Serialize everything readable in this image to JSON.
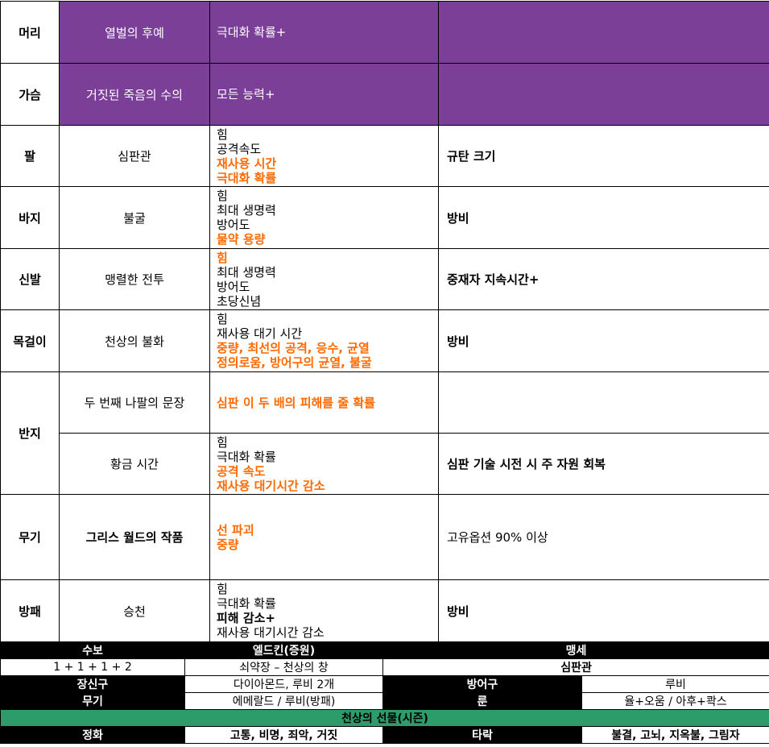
{
  "rows": {
    "head": {
      "slot": "머리",
      "item": "열벌의 후예",
      "stats": [
        "극대화 확률+"
      ],
      "extra": ""
    },
    "chest": {
      "slot": "가슴",
      "item": "거짓된 죽음의 수의",
      "stats": [
        "모든 능력+"
      ],
      "extra": ""
    },
    "arm": {
      "slot": "팔",
      "item": "심판관",
      "stats": [
        "힘",
        "공격속도",
        "재사용 시간",
        "극대화 확률"
      ],
      "extra": "규탄 크기"
    },
    "pants": {
      "slot": "바지",
      "item": "불굴",
      "stats": [
        "힘",
        "최대 생명력",
        "방어도",
        "물약 용량"
      ],
      "extra": "방비"
    },
    "boots": {
      "slot": "신발",
      "item": "맹렬한 전투",
      "stats": [
        "힘",
        "최대 생명력",
        "방어도",
        "초당신념"
      ],
      "extra": "중재자 지속시간+"
    },
    "amulet": {
      "slot": "목걸이",
      "item": "천상의 불화",
      "stats": [
        "힘",
        "재사용 대기 시간",
        "중량, 최선의 공격, 응수, 균열",
        "정의로움, 방어구의 균열, 불굴"
      ],
      "extra": "방비"
    },
    "ring_slot": "반지",
    "ring1": {
      "item": "두 번째 나팔의 문장",
      "stats": [
        "심판 이 두 배의 피해를 줄 확률"
      ],
      "extra": ""
    },
    "ring2": {
      "item": "황금 시간",
      "stats": [
        "힘",
        "극대화 확률",
        "공격 속도",
        "재사용 대기시간 감소"
      ],
      "extra": "심판 기술 시전 시 주 자원 회복"
    },
    "weapon": {
      "slot": "무기",
      "item": "그리스 월드의 작품",
      "stats": [
        "선 파괴",
        "중량"
      ],
      "extra": "고유옵션 90% 이상"
    },
    "shield": {
      "slot": "방패",
      "item": "승천",
      "stats": [
        "힘",
        "극대화 확률",
        "피해 감소+",
        "재사용 대기시간 감소"
      ],
      "extra": "방비"
    }
  },
  "bottom": {
    "r1": {
      "c1": "수보",
      "c2": "엘드킨(증원)",
      "c3": "맹세"
    },
    "r2": {
      "c1": "1 + 1 + 1 + 2",
      "c2": "쇠약장 – 천상의 창",
      "c3": "심판관"
    },
    "r3": {
      "c1": "장신구",
      "c2": "다이아몬드, 루비 2개",
      "c3": "방어구",
      "c4": "루비"
    },
    "r4": {
      "c1": "무기",
      "c2": "에메랄드 / 루비(방패)",
      "c3": "룬",
      "c4": "율+오움 / 아후+콱스"
    },
    "r5": {
      "c1": "천상의 선물(시즌)"
    },
    "r6": {
      "c1": "정화",
      "c2": "고통, 비명, 죄악, 거짓",
      "c3": "타락",
      "c4": "불결, 고뇌, 지옥불, 그림자"
    }
  },
  "colors": {
    "purple": "#7b3f97",
    "orange": "#ff6a00",
    "green": "#2e9c6a",
    "black": "#000000"
  }
}
